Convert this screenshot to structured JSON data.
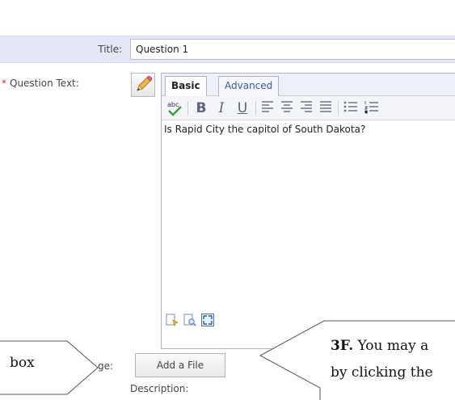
{
  "form": {
    "title_label": "Title:",
    "title_value": "Question 1",
    "question_required_mark": "*",
    "question_label": "Question Text:",
    "image_label_partial": "ge:",
    "add_file_label": "Add a File",
    "description_label": "Description:"
  },
  "editor": {
    "tabs": [
      {
        "label": "Basic",
        "active": true
      },
      {
        "label": "Advanced",
        "active": false
      }
    ],
    "toolbar": {
      "bold": "B",
      "italic": "I",
      "underline": "U"
    },
    "content": "Is Rapid City the capitol of South Dakota?"
  },
  "callouts": {
    "left_text": "box",
    "right_step": "3F.",
    "right_line1": "You may a",
    "right_line2": "by clicking the"
  },
  "colors": {
    "title_row_bg": "#e4e8f6",
    "required": "#d9282e",
    "tab_link": "#3a56a6"
  }
}
